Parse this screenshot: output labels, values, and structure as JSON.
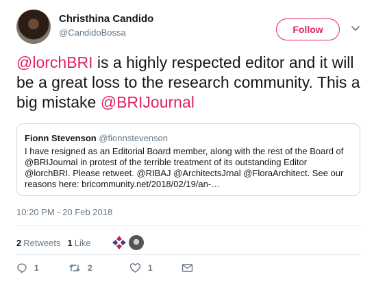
{
  "author": {
    "name": "Christhina Candido",
    "handle": "@CandidoBossa"
  },
  "follow_label": "Follow",
  "tweet": {
    "mention1": "@lorchBRI",
    "text1": " is a highly respected editor and it will be a great loss to the research community. This a big mistake ",
    "mention2": "@BRIJournal"
  },
  "quote": {
    "name": "Fionn Stevenson",
    "handle": "@fionnstevenson",
    "text": "I have resigned as an Editorial Board member, along with the rest of the Board of @BRIJournal in protest of the terrible treatment of its outstanding Editor @lorchBRI. Please retweet.  @RIBAJ @ArchitectsJrnal @FloraArchitect. See our reasons here: bricommunity.net/2018/02/19/an-…"
  },
  "timestamp": "10:20 PM - 20 Feb 2018",
  "stats": {
    "retweets_count": "2",
    "retweets_label": "Retweets",
    "likes_count": "1",
    "likes_label": "Like"
  },
  "actions": {
    "reply_count": "1",
    "retweet_count": "2",
    "like_count": "1"
  },
  "colors": {
    "accent": "#e0245e",
    "muted": "#657786"
  },
  "icons": [
    "chevron-down-icon",
    "reply-icon",
    "retweet-icon",
    "heart-icon",
    "message-icon"
  ]
}
